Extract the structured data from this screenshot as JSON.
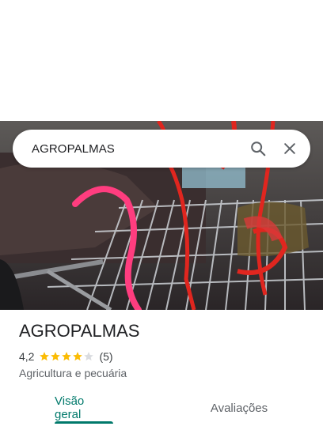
{
  "search": {
    "query": "AGROPALMAS"
  },
  "place": {
    "name": "AGROPALMAS",
    "rating_text": "4,2",
    "rating_value": 4.2,
    "rating_count_text": "(5)",
    "category": "Agricultura e pecuária"
  },
  "tabs": [
    {
      "label": "Visão geral",
      "active": true
    },
    {
      "label": "Avaliações",
      "active": false
    }
  ],
  "colors": {
    "accent": "#00796b",
    "star": "#fbbc04",
    "star_empty": "#dadce0"
  },
  "icons": {
    "search": "search-icon",
    "close": "close-icon"
  }
}
